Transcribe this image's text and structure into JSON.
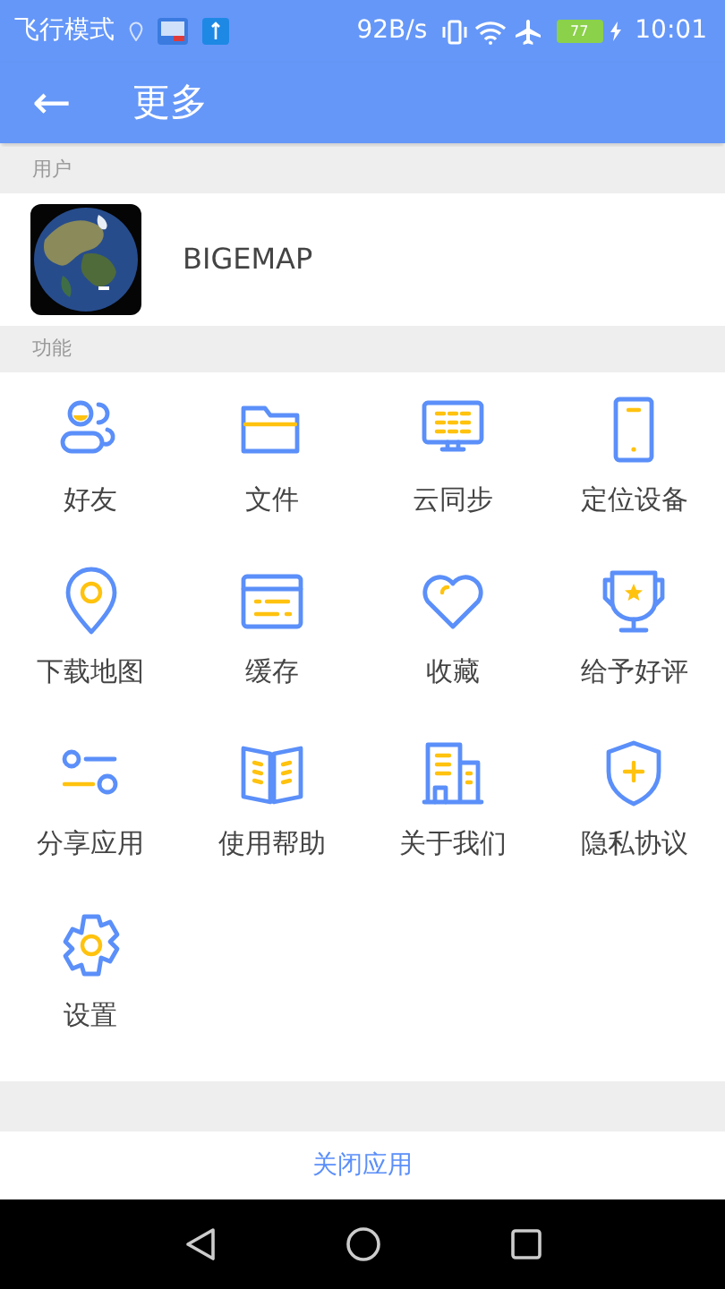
{
  "status_bar": {
    "carrier": "飞行模式",
    "speed": "92B/s",
    "battery": "77",
    "time": "10:01"
  },
  "app_bar": {
    "back": "←",
    "title": "更多"
  },
  "user_section": {
    "header": "用户",
    "name": "BIGEMAP"
  },
  "features_section": {
    "header": "功能",
    "items": [
      {
        "label": "好友"
      },
      {
        "label": "文件"
      },
      {
        "label": "云同步"
      },
      {
        "label": "定位设备"
      },
      {
        "label": "下载地图"
      },
      {
        "label": "缓存"
      },
      {
        "label": "收藏"
      },
      {
        "label": "给予好评"
      },
      {
        "label": "分享应用"
      },
      {
        "label": "使用帮助"
      },
      {
        "label": "关于我们"
      },
      {
        "label": "隐私协议"
      },
      {
        "label": "设置"
      }
    ]
  },
  "close_button": "关闭应用"
}
